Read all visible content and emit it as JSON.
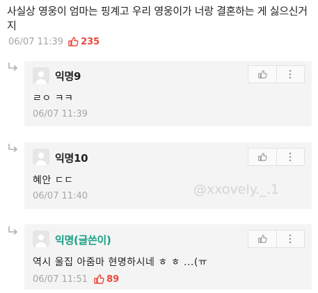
{
  "post": {
    "text": "사실상 영웅이 엄마는 핑계고 우리 영웅이가 너랑 결혼하는 게 싫으신거지",
    "time": "06/07 11:39",
    "likes": "235"
  },
  "comments": [
    {
      "author": "익명9",
      "text": "ㄹㅇ ㅋㅋ",
      "time": "06/07 11:39"
    },
    {
      "author": "익명10",
      "text": "혜안 ㄷㄷ",
      "time": "06/07 11:40"
    },
    {
      "author": "익명(글쓴이)",
      "text": "역시 울집 아줌마 현명하시네 ㅎ ㅎ ...(ㅠ",
      "time": "06/07 11:51",
      "likes": "89"
    }
  ],
  "watermark": "@xxovely._.1",
  "icons": {
    "reply": "reply-arrow-icon",
    "like": "thumbs-up-icon",
    "more": "more-vertical-icon",
    "avatar": "default-avatar-icon"
  },
  "colors": {
    "like_red": "#e8483b",
    "op_green": "#16a085",
    "meta_gray": "#a5a5a5",
    "comment_bg": "#f4f4f4"
  }
}
